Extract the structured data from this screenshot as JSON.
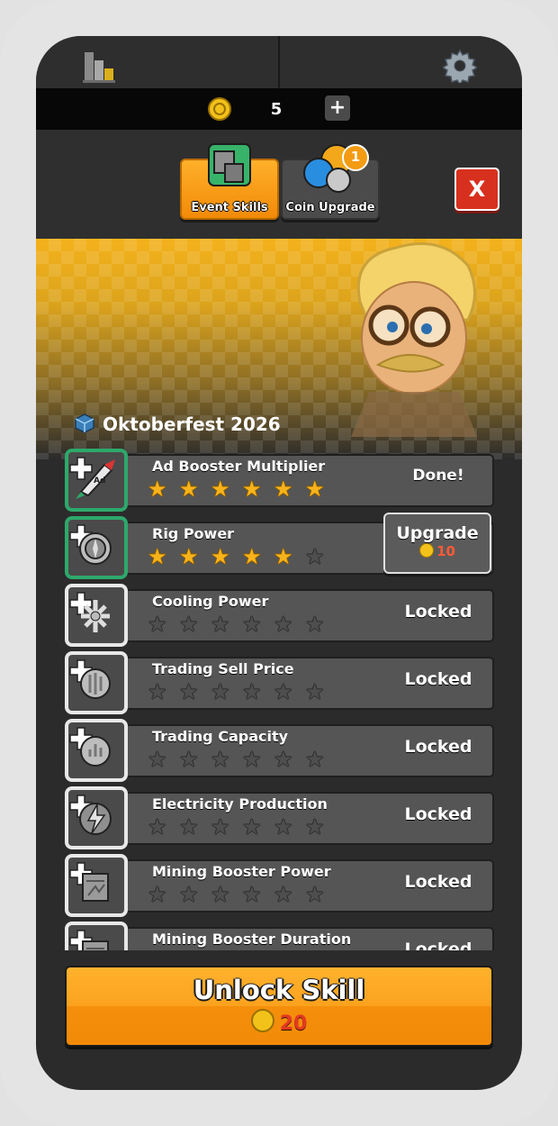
{
  "currency": {
    "coins": "5",
    "add_label": "+"
  },
  "tabs": [
    {
      "label": "Event Skills",
      "active": true
    },
    {
      "label": "Coin Upgrade",
      "active": false,
      "badge": "1"
    }
  ],
  "close_label": "X",
  "event": {
    "title": "Oktoberfest 2026"
  },
  "skills": [
    {
      "name": "Ad Booster Multiplier",
      "stars": 6,
      "max_stars": 6,
      "status": "Done!",
      "state": "done"
    },
    {
      "name": "Rig Power",
      "stars": 5,
      "max_stars": 6,
      "status": "Upgrade",
      "cost": "10",
      "state": "upgrade"
    },
    {
      "name": "Cooling Power",
      "stars": 0,
      "max_stars": 6,
      "status": "Locked",
      "state": "locked"
    },
    {
      "name": "Trading Sell Price",
      "stars": 0,
      "max_stars": 6,
      "status": "Locked",
      "state": "locked"
    },
    {
      "name": "Trading Capacity",
      "stars": 0,
      "max_stars": 6,
      "status": "Locked",
      "state": "locked"
    },
    {
      "name": "Electricity Production",
      "stars": 0,
      "max_stars": 6,
      "status": "Locked",
      "state": "locked"
    },
    {
      "name": "Mining Booster Power",
      "stars": 0,
      "max_stars": 6,
      "status": "Locked",
      "state": "locked"
    },
    {
      "name": "Mining Booster Duration",
      "stars": 0,
      "max_stars": 6,
      "status": "Locked",
      "state": "locked"
    }
  ],
  "unlock": {
    "label": "Unlock Skill",
    "cost": "20"
  },
  "colors": {
    "accent": "#f7a21b",
    "done_border": "#2ea86b",
    "close": "#d8301e",
    "cost_red": "#e33a22"
  },
  "icons": {
    "leaderboard": "leaderboard-icon",
    "settings": "gear-icon",
    "coin": "coin-icon",
    "skills": [
      "rocket-ad-icon",
      "turbine-icon",
      "snowflake-icon",
      "dollar-gauge-icon",
      "gauge-icon",
      "lightning-icon",
      "booster-card-icon",
      "booster-card-icon"
    ]
  }
}
